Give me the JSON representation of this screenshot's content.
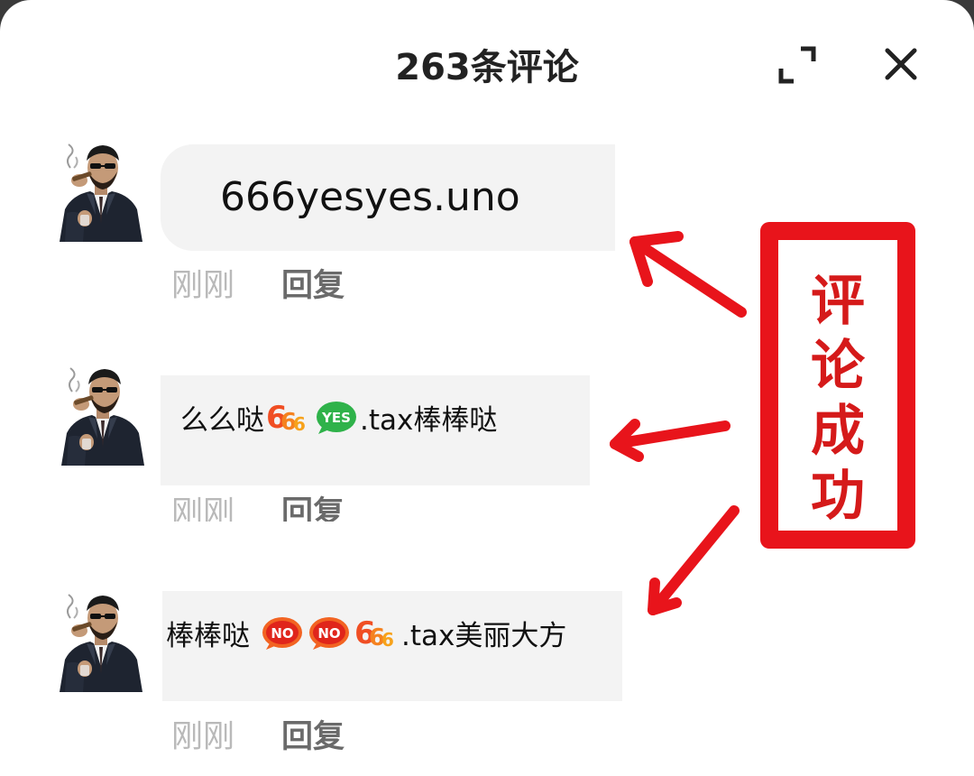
{
  "header": {
    "title": "263条评论",
    "expand_icon": "expand-icon",
    "close_icon": "close-icon"
  },
  "comments": [
    {
      "avatar": "man-in-suit-smoking-cigar-avatar",
      "text": "666yesyes.uno",
      "time": "刚刚",
      "reply": "回复"
    },
    {
      "avatar": "man-in-suit-smoking-cigar-avatar",
      "text_before": "么么哒",
      "stickers": [
        "666-sticker",
        "yes-sticker"
      ],
      "text_after": ".tax棒棒哒",
      "time": "刚刚",
      "reply": "回复"
    },
    {
      "avatar": "man-in-suit-smoking-cigar-avatar",
      "text_before": "棒棒哒",
      "stickers": [
        "no-sticker",
        "no-sticker",
        "666-sticker"
      ],
      "text_after": ".tax美丽大方",
      "time": "刚刚",
      "reply": "回复"
    }
  ],
  "annotation": {
    "chars": [
      "评",
      "论",
      "成",
      "功"
    ],
    "color": "#e8141b"
  },
  "colors": {
    "bubble": "#f3f3f3",
    "time": "#b9b9b9",
    "reply": "#6a6a6a"
  }
}
